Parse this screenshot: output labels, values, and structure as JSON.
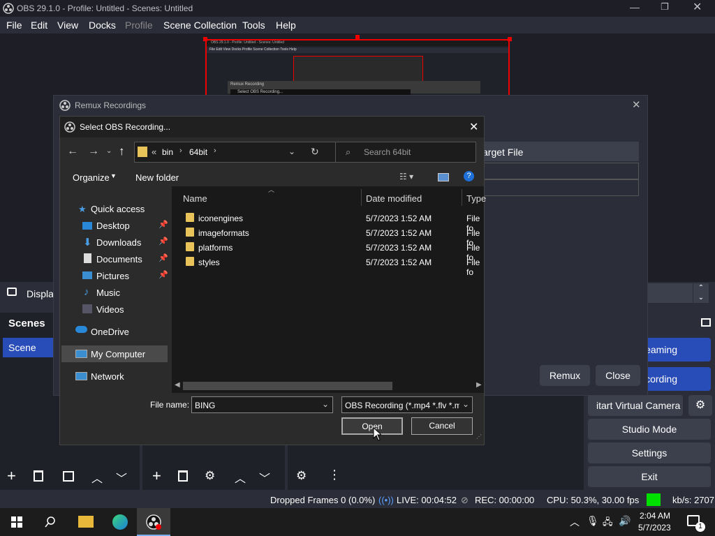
{
  "app": {
    "title": "OBS 29.1.0 - Profile: Untitled - Scenes: Untitled",
    "menu": [
      "File",
      "Edit",
      "View",
      "Docks",
      "Profile",
      "Scene Collection",
      "Tools",
      "Help"
    ]
  },
  "preview_thumb": {
    "title": "OBS 29.1.0 - Profile: Untitled - Scenes: Untitled",
    "menu": [
      "File",
      "Edit",
      "View",
      "Docks",
      "Profile",
      "Scene Collection",
      "Tools",
      "Help"
    ],
    "remux_title": "Remux Recording",
    "select_title": "Select OBS Recording..."
  },
  "docks": {
    "display_label": "Display",
    "scenes_title": "Scenes",
    "scene_item": "Scene",
    "controls": {
      "streaming": "reaming",
      "recording": "ecording",
      "virtual_cam": "itart Virtual Camera",
      "studio": "Studio Mode",
      "settings": "Settings",
      "exit": "Exit"
    }
  },
  "remux": {
    "title": "Remux Recordings",
    "target_col": "arget File",
    "remux_btn": "Remux",
    "close_btn": "Close"
  },
  "dialog": {
    "title": "Select OBS Recording...",
    "path": [
      "bin",
      "64bit"
    ],
    "search_placeholder": "Search 64bit",
    "organize": "Organize",
    "new_folder": "New folder",
    "nav": [
      "Quick access",
      "Desktop",
      "Downloads",
      "Documents",
      "Pictures",
      "Music",
      "Videos",
      "OneDrive",
      "My Computer",
      "Network"
    ],
    "columns": {
      "name": "Name",
      "date": "Date modified",
      "type": "Type"
    },
    "files": [
      {
        "name": "iconengines",
        "date": "5/7/2023 1:52 AM",
        "type": "File fo"
      },
      {
        "name": "imageformats",
        "date": "5/7/2023 1:52 AM",
        "type": "File fo"
      },
      {
        "name": "platforms",
        "date": "5/7/2023 1:52 AM",
        "type": "File fo"
      },
      {
        "name": "styles",
        "date": "5/7/2023 1:52 AM",
        "type": "File fo"
      }
    ],
    "file_name_label": "File name:",
    "file_name_value": "BING",
    "filter": "OBS Recording (*.mp4 *.flv *.m",
    "open": "Open",
    "cancel": "Cancel"
  },
  "status": {
    "dropped": "Dropped Frames 0 (0.0%)",
    "live": "LIVE: 00:04:52",
    "rec": "REC: 00:00:00",
    "cpu": "CPU: 50.3%, 30.00 fps",
    "kbs": "kb/s: 2707",
    "indicator_color": "#00e000"
  },
  "taskbar": {
    "time": "2:04 AM",
    "date": "5/7/2023",
    "notif_count": "1"
  }
}
